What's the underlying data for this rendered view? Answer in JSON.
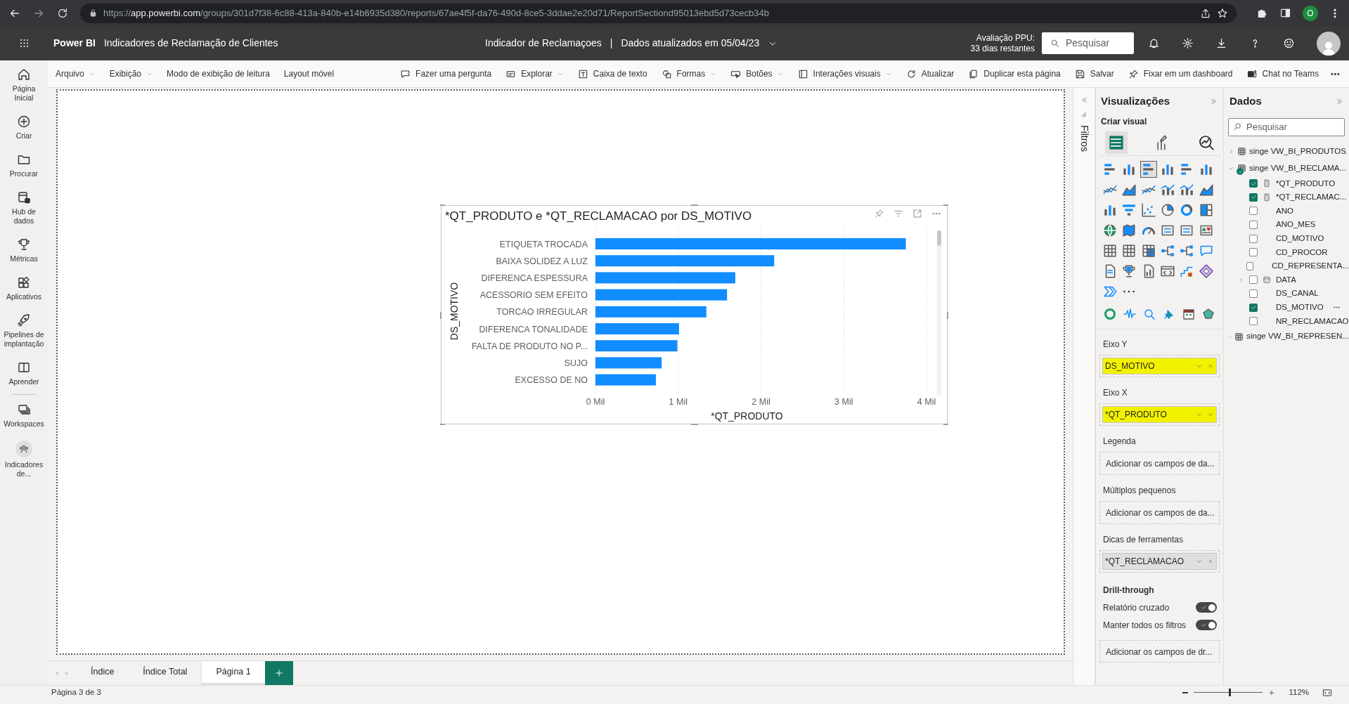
{
  "browser": {
    "url_scheme": "https://",
    "url_host": "app.powerbi.com",
    "url_path": "/groups/301d7f38-6c88-413a-840b-e14b6935d380/reports/67ae4f5f-da76-490d-8ce5-3ddae2e20d71/ReportSectiond95013ebd5d73cecb34b",
    "profile_initial": "O"
  },
  "header": {
    "app_name": "Power BI",
    "report_name": "Indicadores de Reclamação de Clientes",
    "center_title": "Indicador de Reclamaçoes",
    "separator": "|",
    "refresh_text": "Dados atualizados em 05/04/23",
    "trial_label": "Avaliação PPU:",
    "trial_days": "33 dias restantes",
    "search_placeholder": "Pesquisar"
  },
  "nav": [
    {
      "label": "Página Inicial"
    },
    {
      "label": "Criar"
    },
    {
      "label": "Procurar"
    },
    {
      "label": "Hub de dados"
    },
    {
      "label": "Métricas"
    },
    {
      "label": "Aplicativos"
    },
    {
      "label": "Pipelines de implantação"
    },
    {
      "label": "Aprender"
    },
    {
      "label": "Workspaces"
    },
    {
      "label": "Indicadores de..."
    }
  ],
  "ribbon": [
    {
      "label": "Arquivo",
      "dropdown": true
    },
    {
      "label": "Exibição",
      "dropdown": true
    },
    {
      "label": "Modo de exibição de leitura",
      "dropdown": false
    },
    {
      "label": "Layout móvel",
      "dropdown": false
    },
    {
      "label": "Fazer uma pergunta",
      "dropdown": false
    },
    {
      "label": "Explorar",
      "dropdown": true
    },
    {
      "label": "Caixa de texto",
      "dropdown": false
    },
    {
      "label": "Formas",
      "dropdown": true
    },
    {
      "label": "Botões",
      "dropdown": true
    },
    {
      "label": "Interações visuais",
      "dropdown": true
    },
    {
      "label": "Atualizar",
      "dropdown": false
    },
    {
      "label": "Duplicar esta página",
      "dropdown": false
    },
    {
      "label": "Salvar",
      "dropdown": false
    },
    {
      "label": "Fixar em um dashboard",
      "dropdown": false
    },
    {
      "label": "Chat no Teams",
      "dropdown": false
    }
  ],
  "chart": {
    "title": "*QT_PRODUTO e *QT_RECLAMACAO por DS_MOTIVO",
    "chart_data": {
      "type": "bar",
      "grid": true,
      "orientation": "horizontal",
      "xlabel": "*QT_PRODUTO",
      "ylabel": "DS_MOTIVO",
      "categories": [
        "ETIQUETA TROCADA",
        "BAIXA SOLIDEZ A LUZ",
        "DIFERENCA ESPESSURA",
        "ACESSORIO SEM EFEITO",
        "TORCAO IRREGULAR",
        "DIFERENCA TONALIDADE",
        "FALTA DE PRODUTO NO P...",
        "SUJO",
        "EXCESSO DE NO"
      ],
      "values": [
        3.75,
        2.16,
        1.69,
        1.59,
        1.34,
        1.01,
        0.99,
        0.8,
        0.73
      ],
      "xlim": [
        0,
        4
      ],
      "xticks": [
        {
          "value": 0,
          "label": "0 Mil"
        },
        {
          "value": 1,
          "label": "1 Mil"
        },
        {
          "value": 2,
          "label": "2 Mil"
        },
        {
          "value": 3,
          "label": "3 Mil"
        },
        {
          "value": 4,
          "label": "4 Mil"
        }
      ]
    }
  },
  "filters": {
    "label": "Filtros"
  },
  "visualizations": {
    "title": "Visualizações",
    "build_label": "Criar visual",
    "build_tabs": [
      {
        "selected": true
      },
      {
        "selected": false
      },
      {
        "selected": false
      }
    ],
    "visual_types": [
      {
        "selected": false
      },
      {
        "selected": false
      },
      {
        "selected": true
      },
      {
        "selected": false
      },
      {
        "selected": false
      },
      {
        "selected": false
      },
      {
        "selected": false
      },
      {
        "selected": false
      },
      {
        "selected": false
      },
      {
        "selected": false
      },
      {
        "selected": false
      },
      {
        "selected": false
      },
      {
        "selected": false
      },
      {
        "selected": false
      },
      {
        "selected": false
      },
      {
        "selected": false
      },
      {
        "selected": false
      },
      {
        "selected": false
      },
      {
        "selected": false
      },
      {
        "selected": false
      },
      {
        "selected": false
      },
      {
        "selected": false
      },
      {
        "selected": false
      },
      {
        "selected": false
      },
      {
        "selected": false
      },
      {
        "selected": false
      },
      {
        "selected": false
      },
      {
        "selected": false
      },
      {
        "selected": false
      },
      {
        "selected": false
      },
      {
        "selected": false
      },
      {
        "selected": false
      },
      {
        "selected": false
      },
      {
        "selected": false
      },
      {
        "selected": false
      },
      {
        "selected": false
      },
      {
        "selected": false
      },
      {
        "selected": false
      }
    ],
    "wells": [
      {
        "label": "Eixo Y",
        "kind": "field",
        "field": "DS_MOTIVO",
        "highlighted": true
      },
      {
        "label": "Eixo X",
        "kind": "field",
        "field": "*QT_PRODUTO",
        "highlighted": true
      },
      {
        "label": "Legenda",
        "kind": "empty",
        "placeholder": "Adicionar os campos de da..."
      },
      {
        "label": "Múltiplos pequenos",
        "kind": "empty",
        "placeholder": "Adicionar os campos de da..."
      },
      {
        "label": "Dicas de ferramentas",
        "kind": "field",
        "field": "*QT_RECLAMACAO",
        "highlighted": false
      }
    ],
    "drill": {
      "title": "Drill-through",
      "toggles": [
        {
          "label": "Relatório cruzado",
          "on": true
        },
        {
          "label": "Manter todos os filtros",
          "on": true
        }
      ],
      "placeholder": "Adicionar os campos de dr..."
    }
  },
  "data_pane": {
    "title": "Dados",
    "search_placeholder": "Pesquisar",
    "tables": [
      {
        "name": "singe VW_BI_PRODUTOS",
        "expanded": false,
        "in_use": false
      },
      {
        "name": "singe VW_BI_RECLAMA...",
        "expanded": true,
        "in_use": true,
        "children": [
          {
            "name": "*QT_PRODUTO",
            "checked": true,
            "kind": "measure",
            "expandable": false,
            "more_button": false
          },
          {
            "name": "*QT_RECLAMAC...",
            "checked": true,
            "kind": "measure",
            "expandable": false,
            "more_button": false
          },
          {
            "name": "ANO",
            "checked": false,
            "kind": "column",
            "expandable": false,
            "more_button": false
          },
          {
            "name": "ANO_MES",
            "checked": false,
            "kind": "column",
            "expandable": false,
            "more_button": false
          },
          {
            "name": "CD_MOTIVO",
            "checked": false,
            "kind": "column",
            "expandable": false,
            "more_button": false
          },
          {
            "name": "CD_PROCOR",
            "checked": false,
            "kind": "column",
            "expandable": false,
            "more_button": false
          },
          {
            "name": "CD_REPRESENTA...",
            "checked": false,
            "kind": "column",
            "expandable": false,
            "more_button": false
          },
          {
            "name": "DATA",
            "checked": false,
            "kind": "date",
            "expandable": true,
            "more_button": false
          },
          {
            "name": "DS_CANAL",
            "checked": false,
            "kind": "column",
            "expandable": false,
            "more_button": false
          },
          {
            "name": "DS_MOTIVO",
            "checked": true,
            "kind": "column",
            "expandable": false,
            "more_button": true
          },
          {
            "name": "NR_RECLAMACAO",
            "checked": false,
            "kind": "column",
            "expandable": false,
            "more_button": false
          }
        ]
      },
      {
        "name": "singe VW_BI_REPRESEN...",
        "expanded": false,
        "in_use": false
      }
    ]
  },
  "pages": [
    {
      "label": "Índice",
      "selected": false
    },
    {
      "label": "Índice Total",
      "selected": false
    },
    {
      "label": "Página 1",
      "selected": true
    }
  ],
  "status": {
    "page_indicator": "Página 3 de 3",
    "zoom": {
      "level": 0.51,
      "reading": "112%"
    }
  }
}
